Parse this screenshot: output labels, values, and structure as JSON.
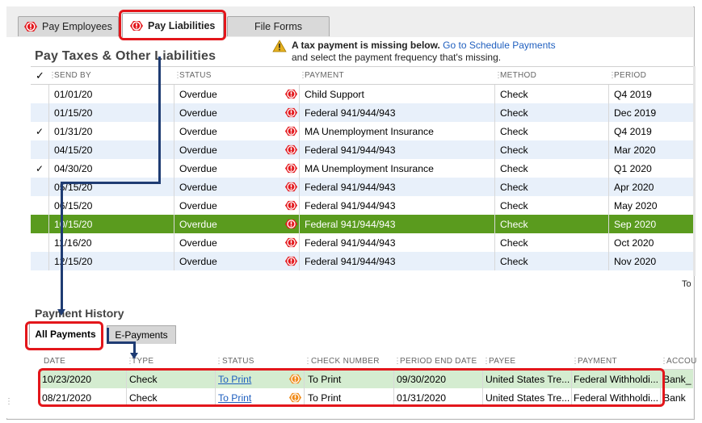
{
  "tabs": [
    {
      "label": "Pay Employees",
      "alert": true,
      "active": false
    },
    {
      "label": "Pay Liabilities",
      "alert": true,
      "active": true
    },
    {
      "label": "File Forms",
      "alert": false,
      "active": false
    }
  ],
  "section_title": "Pay Taxes & Other Liabilities",
  "warning": {
    "bold_text": "A tax payment is missing below.",
    "link_text": "Go to Schedule Payments",
    "second_line": "and select the payment frequency that's missing."
  },
  "liabilities": {
    "check_header": "✓",
    "columns": [
      "SEND BY",
      "STATUS",
      "PAYMENT",
      "METHOD",
      "PERIOD"
    ],
    "rows": [
      {
        "check": "",
        "send_by": "01/01/20",
        "status": "Overdue",
        "payment": "Child Support",
        "method": "Check",
        "period": "Q4 2019"
      },
      {
        "check": "",
        "send_by": "01/15/20",
        "status": "Overdue",
        "payment": "Federal 941/944/943",
        "method": "Check",
        "period": "Dec 2019"
      },
      {
        "check": "✓",
        "send_by": "01/31/20",
        "status": "Overdue",
        "payment": "MA Unemployment Insurance",
        "method": "Check",
        "period": "Q4 2019"
      },
      {
        "check": "",
        "send_by": "04/15/20",
        "status": "Overdue",
        "payment": "Federal 941/944/943",
        "method": "Check",
        "period": "Mar 2020"
      },
      {
        "check": "✓",
        "send_by": "04/30/20",
        "status": "Overdue",
        "payment": "MA Unemployment Insurance",
        "method": "Check",
        "period": "Q1 2020"
      },
      {
        "check": "",
        "send_by": "05/15/20",
        "status": "Overdue",
        "payment": "Federal 941/944/943",
        "method": "Check",
        "period": "Apr 2020"
      },
      {
        "check": "",
        "send_by": "06/15/20",
        "status": "Overdue",
        "payment": "Federal 941/944/943",
        "method": "Check",
        "period": "May 2020"
      },
      {
        "check": "",
        "send_by": "10/15/20",
        "status": "Overdue",
        "payment": "Federal 941/944/943",
        "method": "Check",
        "period": "Sep 2020"
      },
      {
        "check": "",
        "send_by": "11/16/20",
        "status": "Overdue",
        "payment": "Federal 941/944/943",
        "method": "Check",
        "period": "Oct 2020"
      },
      {
        "check": "",
        "send_by": "12/15/20",
        "status": "Overdue",
        "payment": "Federal 941/944/943",
        "method": "Check",
        "period": "Nov 2020"
      }
    ],
    "selected_row": 7,
    "footer_text": "To"
  },
  "history": {
    "title": "Payment History",
    "subtabs": [
      "All Payments",
      "E-Payments"
    ],
    "columns": [
      "DATE",
      "TYPE",
      "STATUS",
      "CHECK NUMBER",
      "PERIOD END DATE",
      "PAYEE",
      "PAYMENT",
      "ACCOU"
    ],
    "rows": [
      {
        "date": "10/23/2020",
        "type": "Check",
        "status": "To Print",
        "check_number": "To Print",
        "period_end": "09/30/2020",
        "payee": "United States Tre...",
        "payment": "Federal Withholdi...",
        "account": "Bank_"
      },
      {
        "date": "08/21/2020",
        "type": "Check",
        "status": "To Print",
        "check_number": "To Print",
        "period_end": "01/31/2020",
        "payee": "United States Tre...",
        "payment": "Federal Withholdi...",
        "account": "Bank"
      }
    ]
  },
  "colors": {
    "selected_row": "#5a9b1e",
    "alt_row": "#e8f0fa",
    "highlight": "#e3161b",
    "arrow": "#1f3c73",
    "alert_red": "#e3161b",
    "warn_orange": "#f08a18"
  }
}
